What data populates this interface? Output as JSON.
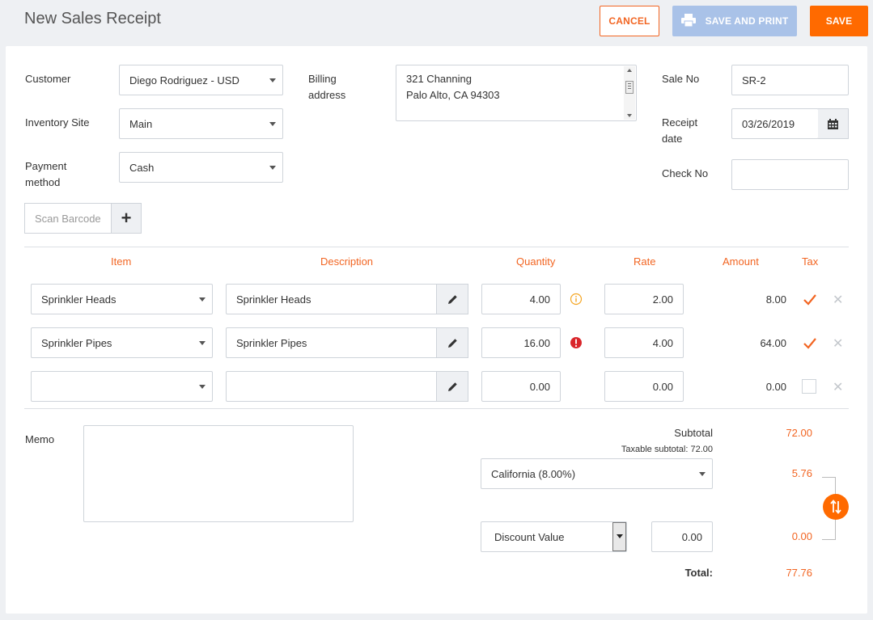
{
  "header": {
    "title": "New Sales Receipt",
    "cancel_label": "CANCEL",
    "save_print_label": "SAVE AND PRINT",
    "save_label": "SAVE"
  },
  "form": {
    "customer_label": "Customer",
    "customer_value": "Diego Rodriguez - USD",
    "inventory_label": "Inventory Site",
    "inventory_value": "Main",
    "payment_label_1": "Payment",
    "payment_label_2": "method",
    "payment_value": "Cash",
    "billing_label_1": "Billing",
    "billing_label_2": "address",
    "billing_line1": "321 Channing",
    "billing_line2": "Palo Alto, CA 94303",
    "sale_no_label": "Sale No",
    "sale_no_value": "SR-2",
    "receipt_date_label_1": "Receipt",
    "receipt_date_label_2": "date",
    "receipt_date_value": "03/26/2019",
    "check_no_label": "Check No",
    "check_no_value": "",
    "scan_placeholder": "Scan Barcode",
    "scan_add": "+"
  },
  "table": {
    "headers": {
      "item": "Item",
      "description": "Description",
      "quantity": "Quantity",
      "rate": "Rate",
      "amount": "Amount",
      "tax": "Tax"
    },
    "rows": [
      {
        "item": "Sprinkler Heads",
        "description": "Sprinkler Heads",
        "quantity": "4.00",
        "status": "info",
        "rate": "2.00",
        "amount": "8.00",
        "taxable": true
      },
      {
        "item": "Sprinkler Pipes",
        "description": "Sprinkler Pipes",
        "quantity": "16.00",
        "status": "error",
        "rate": "4.00",
        "amount": "64.00",
        "taxable": true
      },
      {
        "item": "",
        "description": "",
        "quantity": "0.00",
        "status": "none",
        "rate": "0.00",
        "amount": "0.00",
        "taxable": false
      }
    ]
  },
  "footer": {
    "memo_label": "Memo",
    "memo_value": "",
    "subtotal_label": "Subtotal",
    "subtotal_value": "72.00",
    "taxable_subtotal": "Taxable subtotal: 72.00",
    "tax_select": "California (8.00%)",
    "tax_value": "5.76",
    "discount_select": "Discount Value",
    "discount_input": "0.00",
    "discount_value": "0.00",
    "total_label": "Total:",
    "total_value": "77.76"
  },
  "colors": {
    "accent": "#f26522",
    "save_button": "#ff6a00",
    "print_button_disabled": "#a9c2e8",
    "error_icon": "#d9262b",
    "info_icon": "#f5a623"
  }
}
